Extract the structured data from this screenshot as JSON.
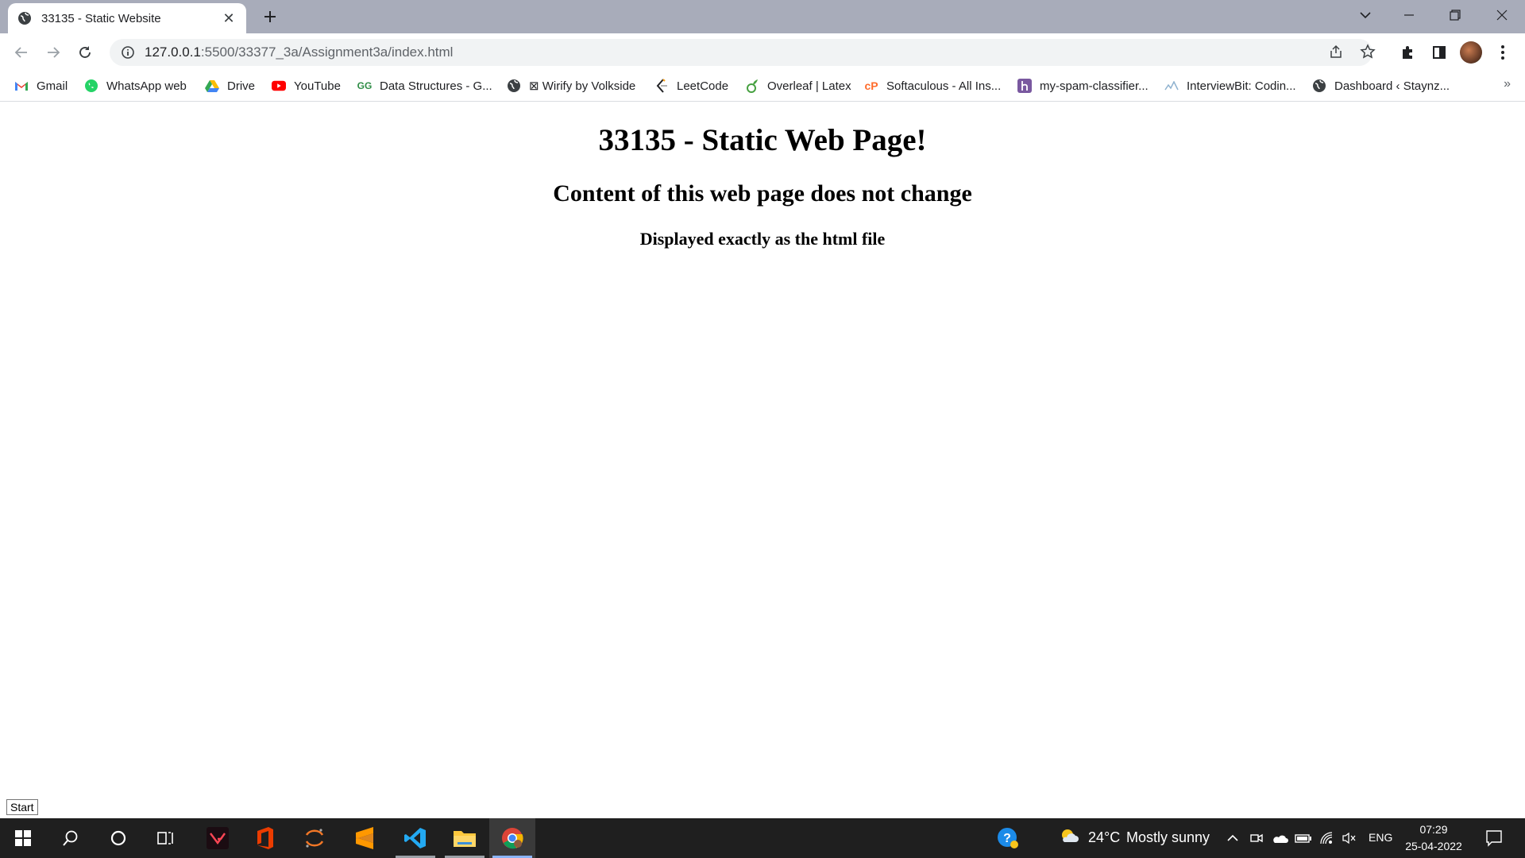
{
  "browser": {
    "tab_title": "33135 - Static Website",
    "url_host": "127.0.0.1",
    "url_rest": ":5500/33377_3a/Assignment3a/index.html"
  },
  "bookmarks": [
    {
      "label": "Gmail",
      "icon": "gmail-icon"
    },
    {
      "label": "WhatsApp web",
      "icon": "whatsapp-icon"
    },
    {
      "label": "Drive",
      "icon": "drive-icon"
    },
    {
      "label": "YouTube",
      "icon": "youtube-icon"
    },
    {
      "label": "Data Structures - G...",
      "icon": "geeksforgeeks-icon"
    },
    {
      "label": "⊠ Wirify by Volkside",
      "icon": "globe-icon"
    },
    {
      "label": "LeetCode",
      "icon": "leetcode-icon"
    },
    {
      "label": "Overleaf | Latex",
      "icon": "overleaf-icon"
    },
    {
      "label": "Softaculous - All Ins...",
      "icon": "softaculous-icon"
    },
    {
      "label": "my-spam-classifier...",
      "icon": "heroku-icon"
    },
    {
      "label": "InterviewBit: Codin...",
      "icon": "interviewbit-icon"
    },
    {
      "label": "Dashboard ‹ Staynz...",
      "icon": "globe-icon"
    }
  ],
  "page": {
    "h1": "33135 - Static Web Page!",
    "h2": "Content of this web page does not change",
    "h3": "Displayed exactly as the html file"
  },
  "tooltip": "Start",
  "taskbar": {
    "weather_temp": "24°C",
    "weather_desc": "Mostly sunny",
    "language": "ENG",
    "time": "07:29",
    "date": "25-04-2022"
  }
}
